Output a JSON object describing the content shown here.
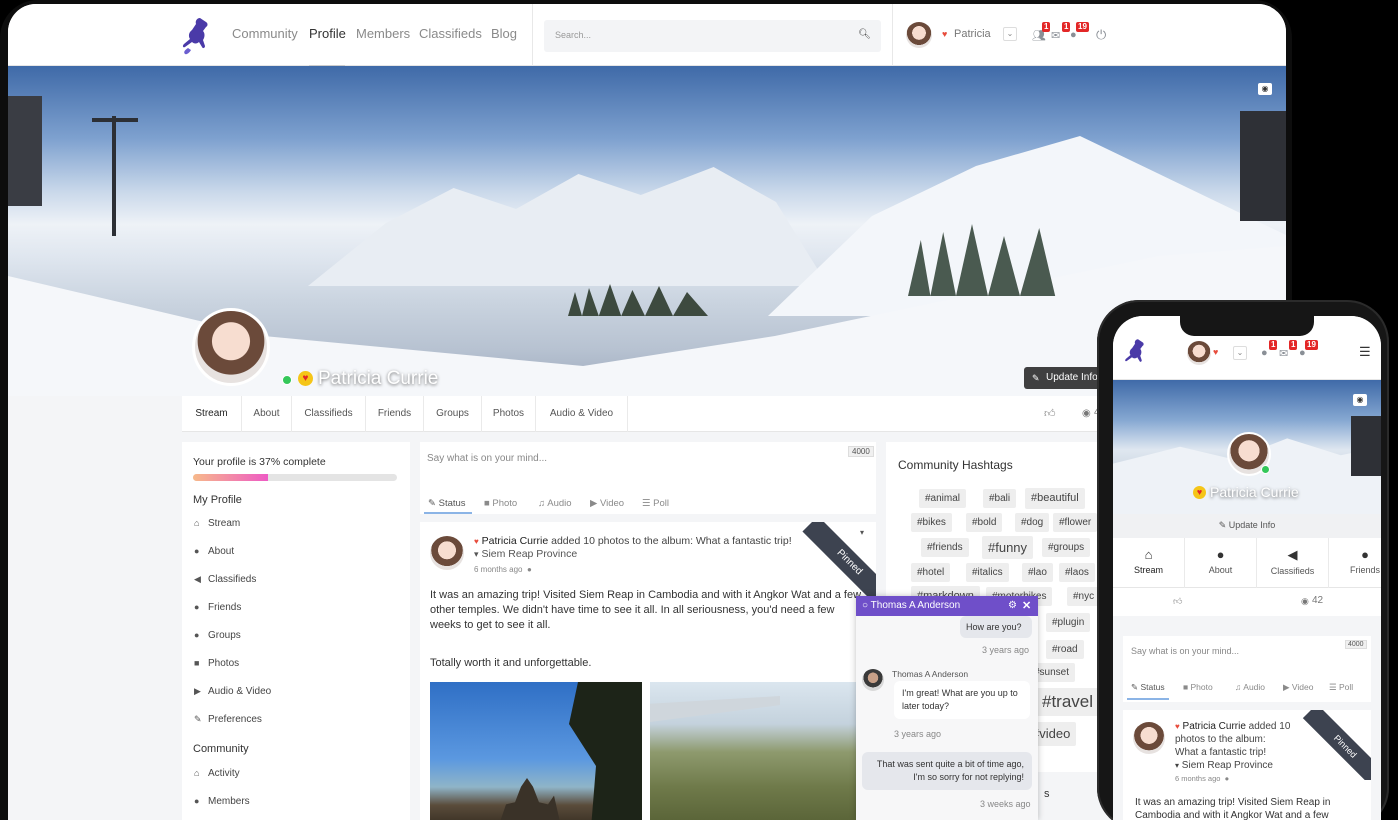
{
  "nav": {
    "links": [
      "Community",
      "Profile",
      "Members",
      "Classifieds",
      "Blog"
    ],
    "active": "Profile",
    "search_placeholder": "Search...",
    "user_name": "Patricia",
    "badges": {
      "friends": "1",
      "messages": "1",
      "notifications": "19"
    }
  },
  "profile": {
    "name": "Patricia Currie",
    "update_info": "Update Info",
    "views": "42"
  },
  "tabs": [
    "Stream",
    "About",
    "Classifieds",
    "Friends",
    "Groups",
    "Photos",
    "Audio & Video"
  ],
  "sidebar": {
    "completion": "Your profile is 37% complete",
    "completion_fraction": 0.37,
    "my_profile_heading": "My Profile",
    "my_profile_items": [
      {
        "label": "Stream",
        "icon": "home-icon"
      },
      {
        "label": "About",
        "icon": "user-icon"
      },
      {
        "label": "Classifieds",
        "icon": "megaphone-icon"
      },
      {
        "label": "Friends",
        "icon": "users-icon"
      },
      {
        "label": "Groups",
        "icon": "group-icon"
      },
      {
        "label": "Photos",
        "icon": "camera-icon"
      },
      {
        "label": "Audio & Video",
        "icon": "video-icon"
      },
      {
        "label": "Preferences",
        "icon": "edit-icon"
      }
    ],
    "community_heading": "Community",
    "community_items": [
      {
        "label": "Activity",
        "icon": "home-icon"
      },
      {
        "label": "Members",
        "icon": "users-icon"
      }
    ]
  },
  "composer": {
    "placeholder": "Say what is on your mind...",
    "char_limit": "4000",
    "tabs": [
      "Status",
      "Photo",
      "Audio",
      "Video",
      "Poll"
    ]
  },
  "post": {
    "author": "Patricia Currie",
    "action": "added 10 photos to the album: What a fantastic trip!",
    "location": "Siem Reap Province",
    "time": "6 months ago",
    "pinned": "Pinned",
    "body1": "It was an amazing trip! Visited Siem Reap in Cambodia and with it Angkor Wat and a few other temples. We didn't have time to see it all. In all seriousness, you'd need a few weeks to get to see it all.",
    "body2": "Totally worth it and unforgettable."
  },
  "hashtags": {
    "title": "Community Hashtags",
    "tags": [
      "#animal",
      "#bali",
      "#beautiful",
      "#bikes",
      "#bold",
      "#dog",
      "#flower",
      "#friends",
      "#funny",
      "#groups",
      "#hotel",
      "#italics",
      "#lao",
      "#laos",
      "#markdown",
      "#motorbikes",
      "#nyc",
      "#plugin",
      "#road",
      "#sunset",
      "#travel",
      "#video"
    ],
    "partial_heading_tail": "s"
  },
  "chat": {
    "name": "Thomas A Anderson",
    "messages": [
      {
        "from": "me",
        "text": "How are you?",
        "time": "3 years ago"
      },
      {
        "from": "Thomas A Anderson",
        "text": "I'm great! What are you up to later today?",
        "time": "3 years ago"
      },
      {
        "from": "me",
        "text": "That was sent quite a bit of time ago, I'm so sorry for not replying!",
        "time": "3 weeks ago"
      }
    ]
  },
  "phone": {
    "name": "Patricia Currie",
    "update_info": "Update Info",
    "tabs": [
      "Stream",
      "About",
      "Classifieds",
      "Friends"
    ],
    "views": "42",
    "composer_placeholder": "Say what is on your mind...",
    "char_limit": "4000",
    "composer_tabs": [
      "Status",
      "Photo",
      "Audio",
      "Video",
      "Poll"
    ],
    "post_author": "Patricia Currie",
    "post_action_1": "added 10",
    "post_action_2": "photos to the album:",
    "post_action_3": "What a fantastic trip!",
    "post_location": "Siem Reap Province",
    "post_time": "6 months ago",
    "pinned": "Pinned",
    "post_body_1": "It was an amazing trip! Visited Siem Reap in",
    "post_body_2": "Cambodia and with it Angkor Wat and a few",
    "badges": {
      "friends": "1",
      "messages": "1",
      "notifications": "19"
    }
  },
  "colors": {
    "accent": "#6f4fc9",
    "badge": "#e32727",
    "online": "#34c759",
    "progress_start": "#f7b98a",
    "progress_end": "#ee5bc4"
  }
}
